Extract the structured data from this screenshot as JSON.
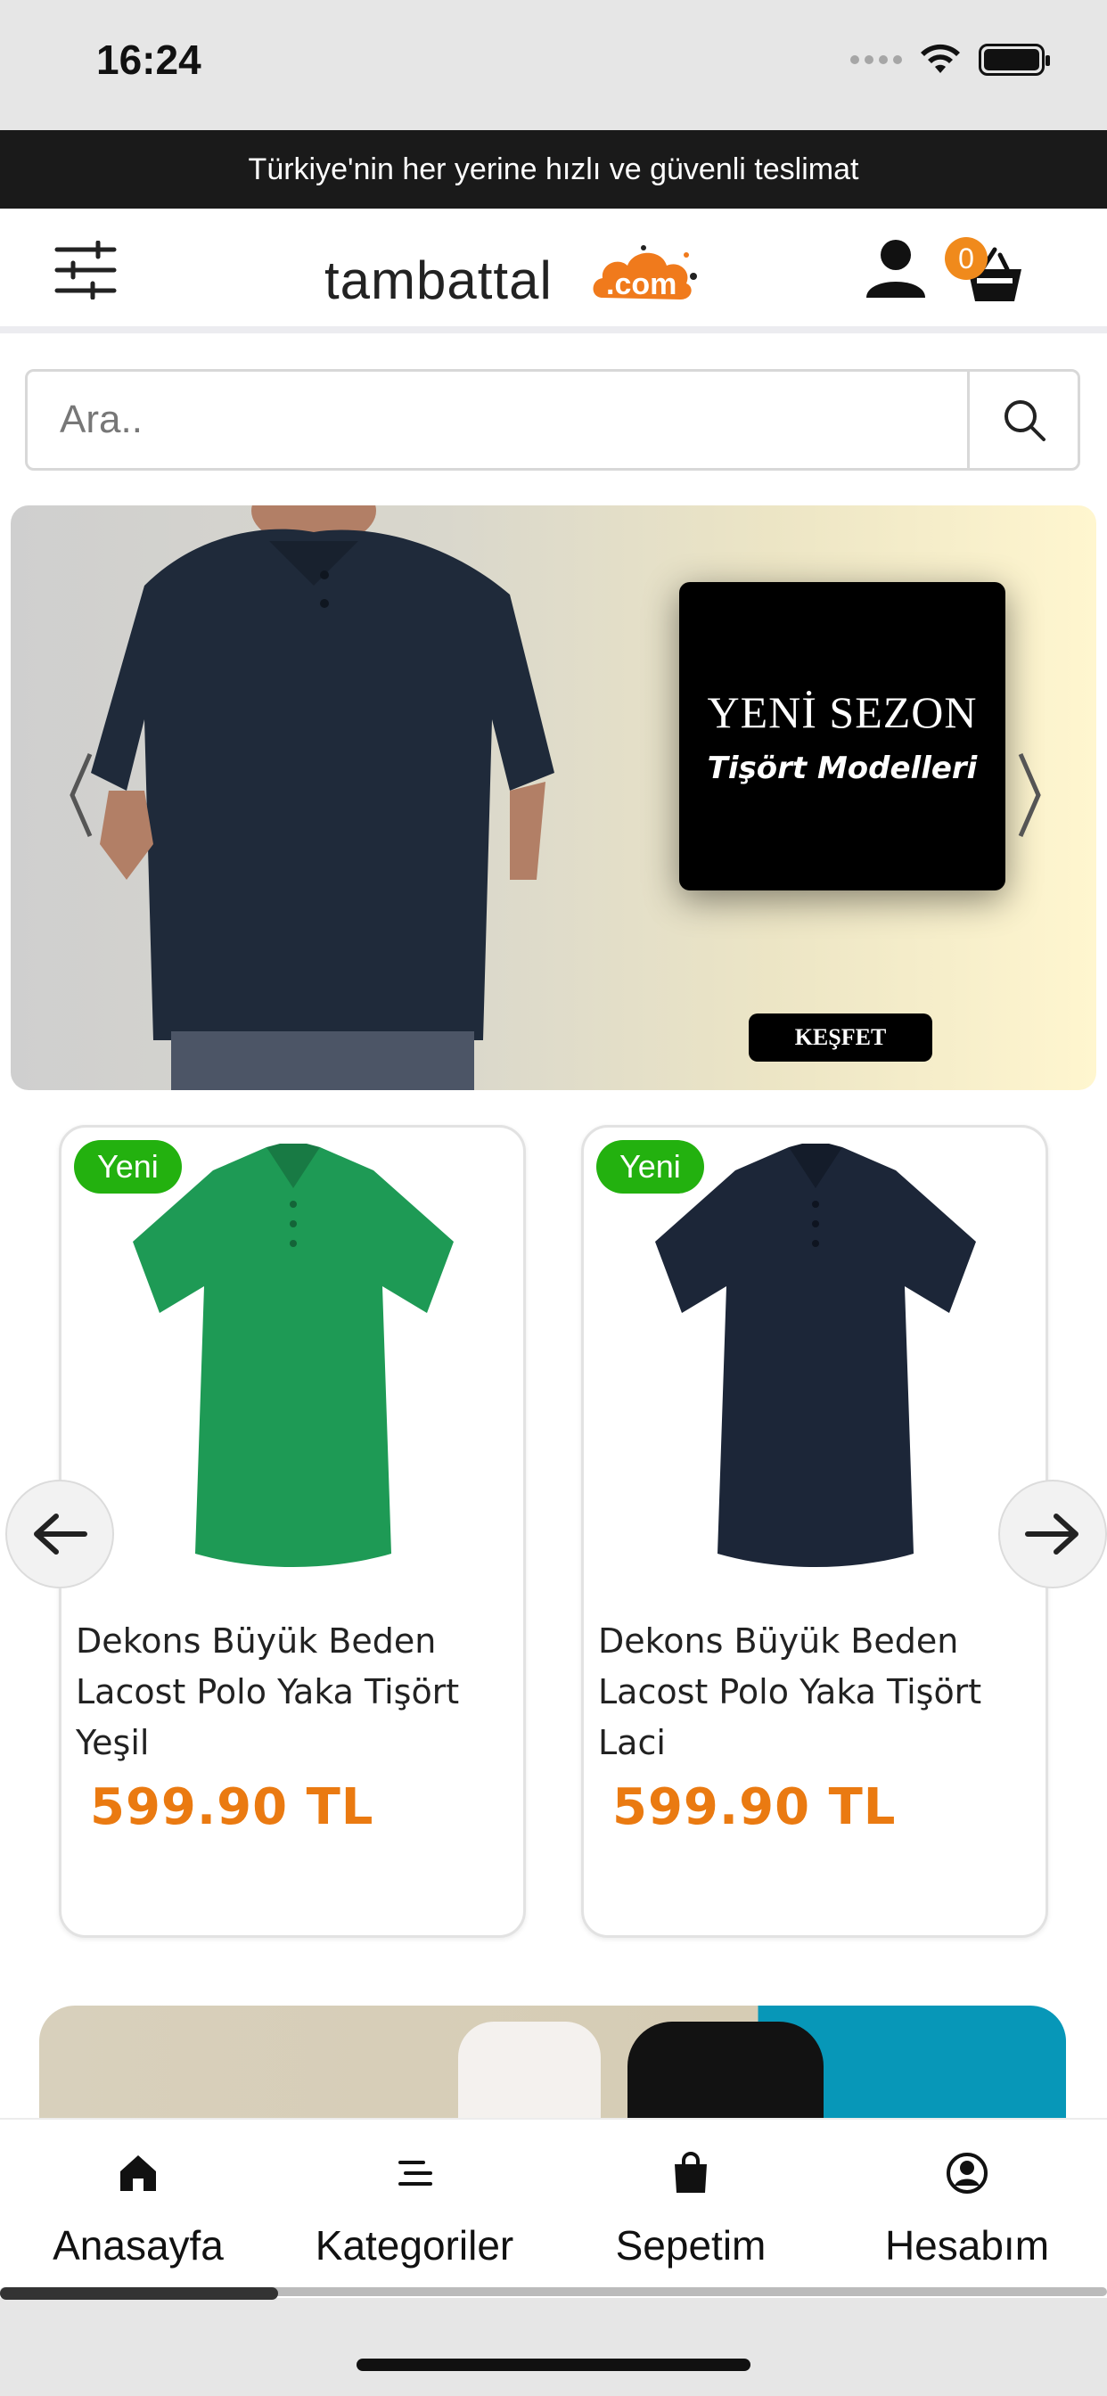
{
  "status_bar": {
    "time": "16:24"
  },
  "announcement": {
    "text": "Türkiye'nin her yerine hızlı ve güvenli teslimat"
  },
  "header": {
    "logo_main": "tambattal",
    "logo_suffix": ".com",
    "cart_count": "0"
  },
  "search": {
    "placeholder": "Ara.."
  },
  "hero": {
    "title": "YENİ SEZON",
    "subtitle": "Tişört Modelleri",
    "cta": "KEŞFET"
  },
  "products": [
    {
      "badge": "Yeni",
      "name": "Dekons Büyük Beden Lacost Polo Yaka Tişört Yeşil",
      "price": "599.90 TL",
      "color": "#1e9a55"
    },
    {
      "badge": "Yeni",
      "name": "Dekons Büyük Beden Lacost Polo Yaka Tişört Laci",
      "price": "599.90 TL",
      "color": "#1c2638"
    }
  ],
  "tabbar": {
    "items": [
      {
        "label": "Anasayfa",
        "icon": "home-icon"
      },
      {
        "label": "Kategoriler",
        "icon": "menu-lines-icon"
      },
      {
        "label": "Sepetim",
        "icon": "shopping-bag-icon"
      },
      {
        "label": "Hesabım",
        "icon": "account-circle-icon"
      }
    ]
  },
  "colors": {
    "accent": "#f08a1c",
    "price": "#ea7a11",
    "badge_green": "#23b10f",
    "announcement_bg": "#1a1a1a"
  }
}
